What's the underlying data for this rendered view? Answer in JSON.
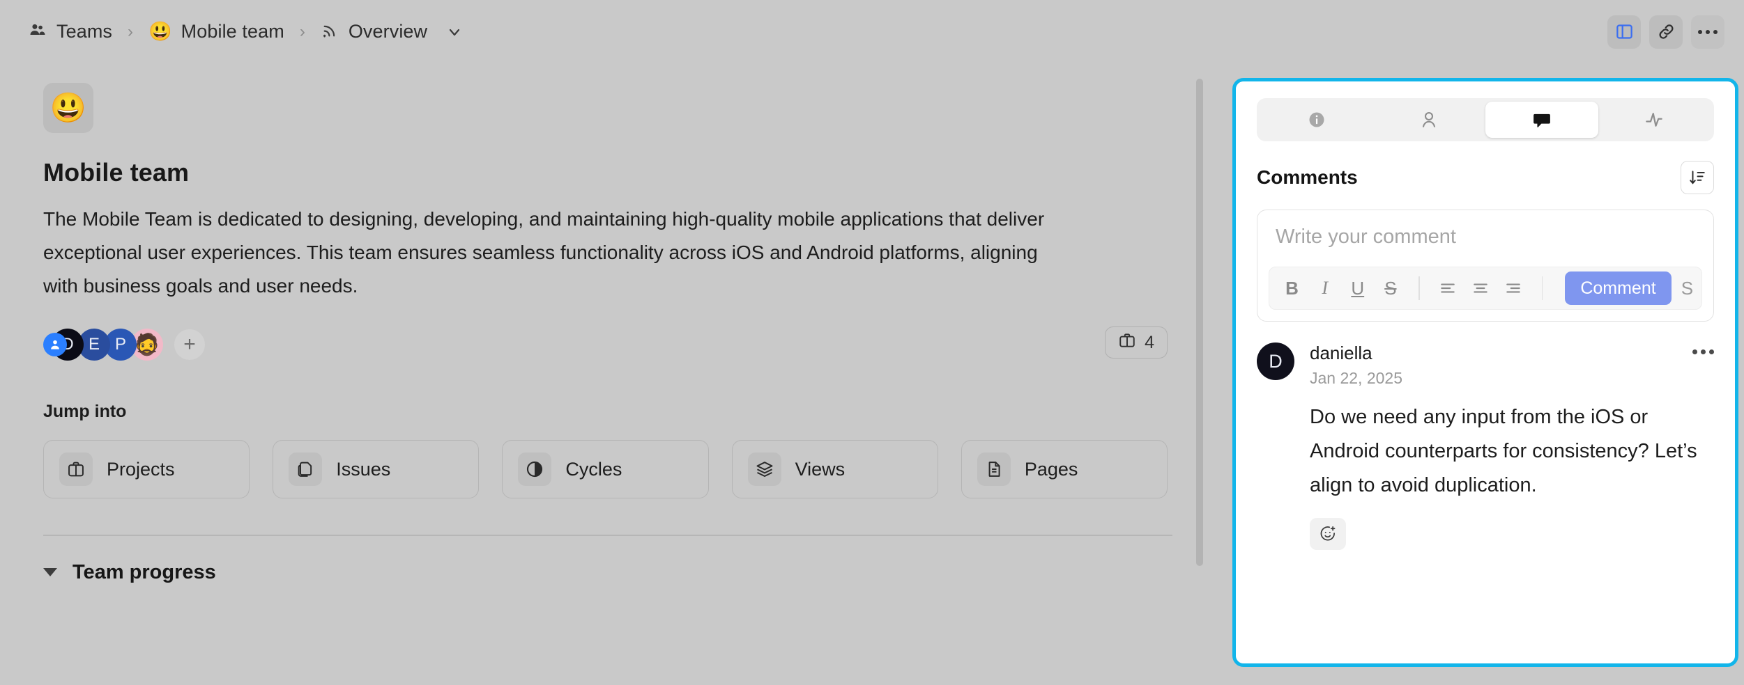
{
  "topbar": {
    "breadcrumb": [
      {
        "icon": "teams-icon",
        "label": "Teams"
      },
      {
        "icon": "emoji-grinning",
        "emoji": "😃",
        "label": "Mobile team"
      },
      {
        "icon": "broadcast-icon",
        "label": "Overview"
      }
    ],
    "separator": "›",
    "actions": [
      {
        "name": "toggle-sidebar-button",
        "icon": "panel-layout-icon"
      },
      {
        "name": "copy-link-button",
        "icon": "link-icon"
      },
      {
        "name": "more-options-button",
        "icon": "ellipsis-icon"
      }
    ]
  },
  "main": {
    "team_emoji": "😃",
    "title": "Mobile team",
    "description": "The Mobile Team is dedicated to designing, developing, and maintaining high-quality mobile applications that deliver exceptional user experiences. This team ensures seamless functionality across iOS and Android platforms, aligning with business goals and user needs.",
    "members": [
      {
        "name": "member-badge",
        "type": "badge",
        "icon": "person-badge-icon"
      },
      {
        "name": "avatar-d",
        "initial": "D",
        "color": "#0b0b16"
      },
      {
        "name": "avatar-e",
        "initial": "E",
        "color": "#2a4d9e"
      },
      {
        "name": "avatar-p",
        "initial": "P",
        "color": "#2a57b5"
      },
      {
        "name": "avatar-photo",
        "initial": "🧔",
        "color": "#f2b9c8"
      }
    ],
    "add_member_label": "+",
    "projects_chip": {
      "icon": "briefcase-icon",
      "count": "4"
    },
    "jump_into_title": "Jump into",
    "jump_cards": [
      {
        "name": "jump-card-projects",
        "icon": "briefcase-icon",
        "label": "Projects"
      },
      {
        "name": "jump-card-issues",
        "icon": "layers-copy-icon",
        "label": "Issues"
      },
      {
        "name": "jump-card-cycles",
        "icon": "contrast-circle-icon",
        "label": "Cycles"
      },
      {
        "name": "jump-card-views",
        "icon": "stack-icon",
        "label": "Views"
      },
      {
        "name": "jump-card-pages",
        "icon": "document-icon",
        "label": "Pages"
      }
    ],
    "team_progress_label": "Team progress"
  },
  "panel": {
    "tabs": [
      {
        "name": "tab-info",
        "icon": "info-icon",
        "active": false
      },
      {
        "name": "tab-members",
        "icon": "person-icon",
        "active": false
      },
      {
        "name": "tab-comments",
        "icon": "comment-bubble-icon",
        "active": true
      },
      {
        "name": "tab-activity",
        "icon": "activity-pulse-icon",
        "active": false
      }
    ],
    "comments_title": "Comments",
    "sort_icon": "sort-descending-icon",
    "editor": {
      "placeholder": "Write your comment",
      "value": "",
      "tools": [
        {
          "name": "bold-button",
          "label": "B"
        },
        {
          "name": "italic-button",
          "label": "I"
        },
        {
          "name": "underline-button",
          "label": "U"
        },
        {
          "name": "strikethrough-button",
          "label": "S"
        },
        {
          "name": "align-left-button",
          "label": "align-left-icon"
        },
        {
          "name": "align-center-button",
          "label": "align-center-icon"
        },
        {
          "name": "align-right-button",
          "label": "align-right-icon"
        }
      ],
      "submit_label": "Comment",
      "overflow_hint": "S"
    },
    "comments": [
      {
        "name": "comment-daniella",
        "avatar_initial": "D",
        "author": "daniella",
        "date": "Jan 22, 2025",
        "body": "Do we need any input from the iOS or Android counterparts for consistency? Let’s align to avoid duplication.",
        "reaction_icon": "add-reaction-icon"
      }
    ]
  },
  "colors": {
    "accent_blue": "#2b7fff",
    "highlight_border": "#12b5ea",
    "comment_button": "#7f96ef",
    "page_bg": "#c9c9c9",
    "panel_bg": "#ffffff"
  }
}
